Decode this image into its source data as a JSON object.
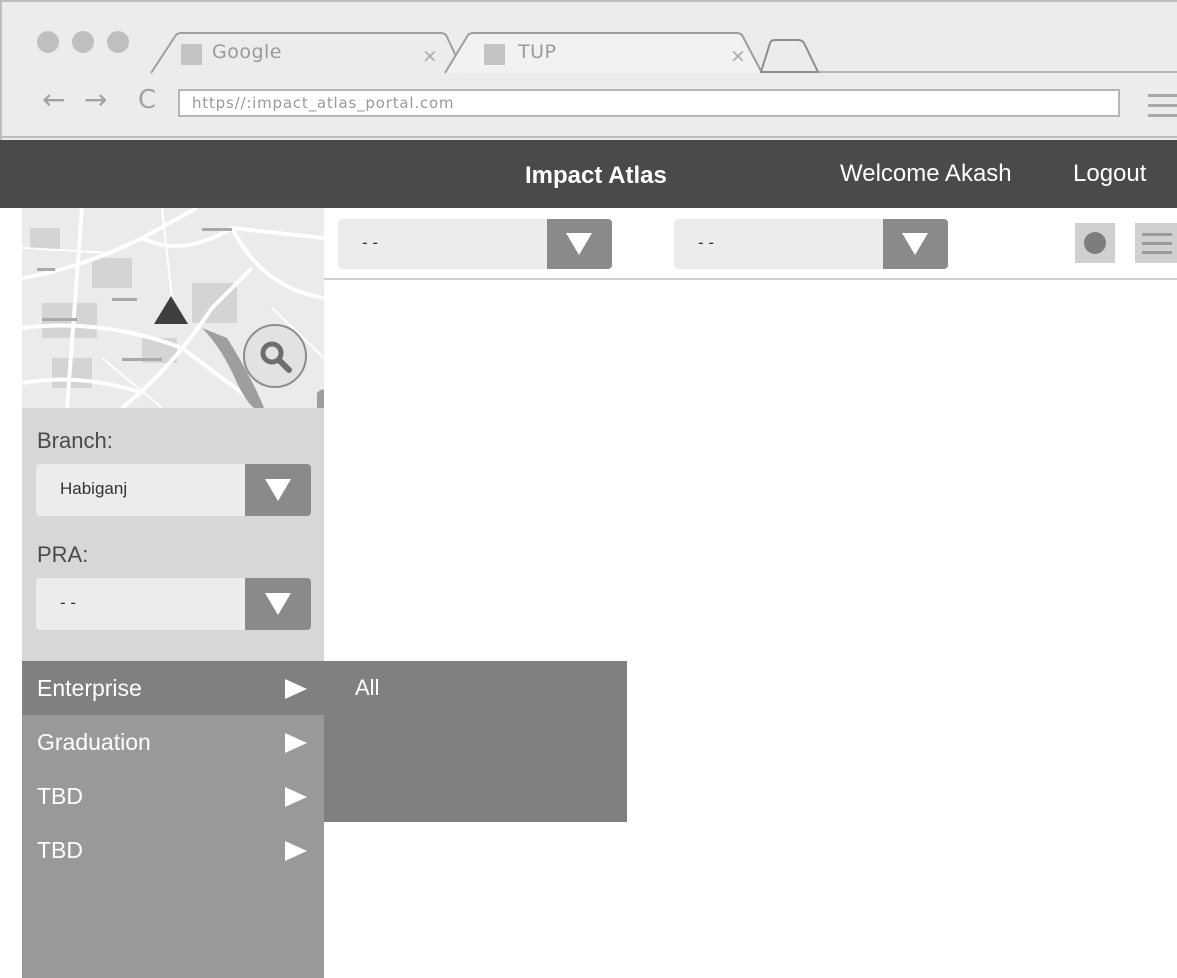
{
  "browser": {
    "tabs": [
      {
        "title": "Google",
        "close": "×"
      },
      {
        "title": "TUP",
        "close": "×"
      }
    ],
    "nav": {
      "back": "←",
      "forward": "→",
      "reload": "C"
    },
    "url": "https//:impact_atlas_portal.com"
  },
  "header": {
    "brand": "Impact Atlas",
    "welcome": "Welcome Akash",
    "logout": "Logout"
  },
  "filters": {
    "first": "- -",
    "second": "- -"
  },
  "sidebar": {
    "branch_label": "Branch:",
    "branch_value": "Habiganj",
    "pra_label": "PRA:",
    "pra_value": "- -",
    "menu": [
      {
        "label": "Enterprise",
        "active": true
      },
      {
        "label": "Graduation"
      },
      {
        "label": "TBD"
      },
      {
        "label": "TBD"
      }
    ]
  },
  "submenu": {
    "items": [
      "All"
    ]
  },
  "icons": {
    "map_marker": "triangle-marker-icon",
    "map_search": "magnifier-icon",
    "dropdown": "triangle-down-icon",
    "submenu_caret": "triangle-right-icon",
    "view_toggle": "circle-icon",
    "list_view": "hamburger-icon"
  },
  "colors": {
    "header_bg": "#4a4a4a",
    "sidebar_bg": "#d7d7d7",
    "menu_bg": "#999999",
    "menu_active": "#808080"
  }
}
